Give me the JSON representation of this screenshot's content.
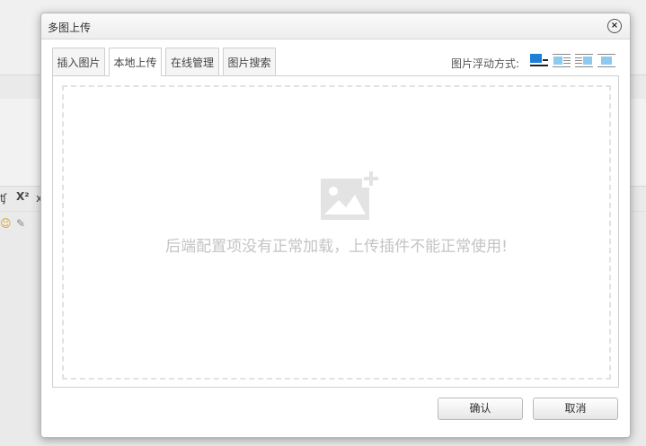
{
  "dialog": {
    "title": "多图上传",
    "close_icon": "close-icon"
  },
  "tabs": [
    {
      "label": "插入图片"
    },
    {
      "label": "本地上传",
      "active": true
    },
    {
      "label": "在线管理"
    },
    {
      "label": "图片搜索"
    }
  ],
  "float": {
    "label": "图片浮动方式:",
    "options": [
      "float-none-icon",
      "float-left-icon",
      "float-right-icon",
      "float-center-icon"
    ]
  },
  "upload": {
    "icon": "add-image-icon",
    "message": "后端配置项没有正常加载，上传插件不能正常使用!"
  },
  "buttons": {
    "ok": "确认",
    "cancel": "取消"
  },
  "colors": {
    "accent": "#3a8fd6",
    "muted_text": "#c4c4c4"
  }
}
